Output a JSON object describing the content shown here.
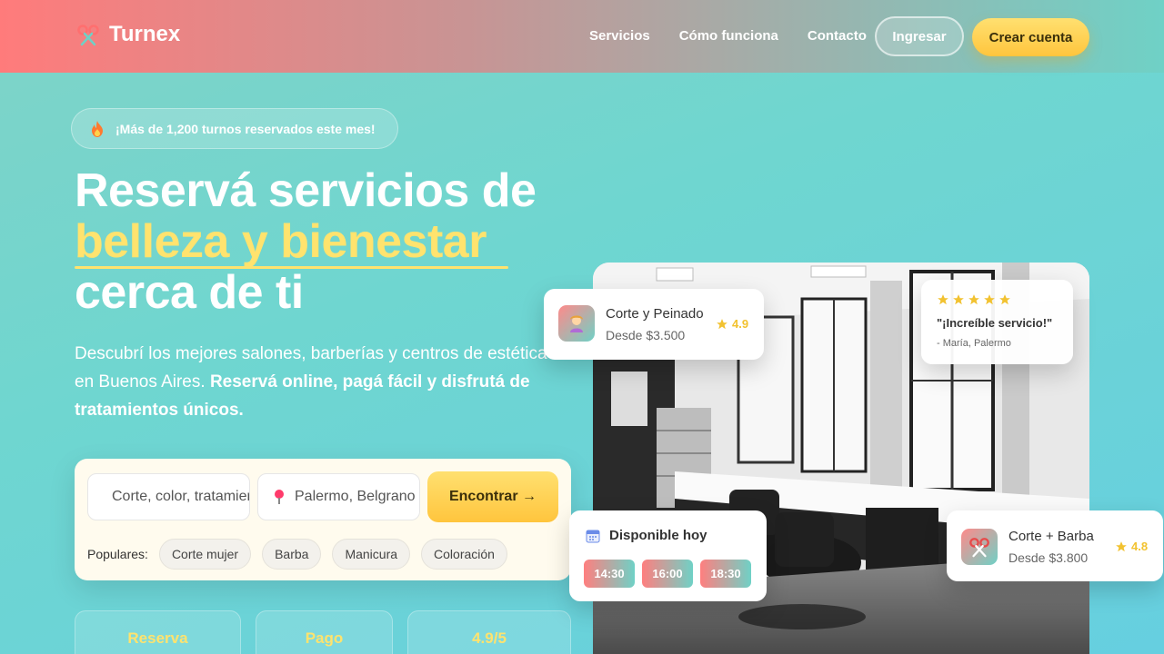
{
  "brand": {
    "name": "Turnex"
  },
  "nav": {
    "links": [
      "Servicios",
      "Cómo funciona",
      "Contacto"
    ],
    "login": "Ingresar",
    "signup": "Crear cuenta"
  },
  "hero": {
    "badge": "¡Más de 1,200 turnos reservados este mes!",
    "title_line1": "Reservá servicios de",
    "title_line2": "belleza y bienestar",
    "title_line3": "cerca de ti",
    "desc_part1": "Descubrí los mejores salones, barberías y centros de estética en Buenos Aires. ",
    "desc_bold": "Reservá online, pagá fácil y disfrutá de tratamientos únicos."
  },
  "search": {
    "service_placeholder": "Corte, color, tratamientos",
    "location_placeholder": "Palermo, Belgrano",
    "button": "Encontrar →",
    "popular_label": "Populares:",
    "popular": [
      "Corte mujer",
      "Barba",
      "Manicura",
      "Coloración"
    ]
  },
  "stats": [
    "Reserva",
    "Pago",
    "4.9/5"
  ],
  "cards": {
    "service1": {
      "name": "Corte y Peinado",
      "price": "Desde $3.500",
      "rating": "4.9"
    },
    "review": {
      "quote": "\"¡Increíble servicio!\"",
      "author": "- María, Palermo"
    },
    "availability": {
      "title": "Disponible hoy",
      "slots": [
        "14:30",
        "16:00",
        "18:30"
      ]
    },
    "service2": {
      "name": "Corte + Barba",
      "price": "Desde $3.800",
      "rating": "4.8"
    }
  },
  "colors": {
    "accent_yellow": "#ffe36e",
    "button_yellow": "#ffc53d",
    "coral": "#ff7b7b",
    "teal": "#6fd1c6"
  },
  "icons": [
    "scissors-icon",
    "fire-icon",
    "search-icon",
    "pin-icon",
    "star-icon",
    "calendar-icon",
    "salon-photo"
  ]
}
